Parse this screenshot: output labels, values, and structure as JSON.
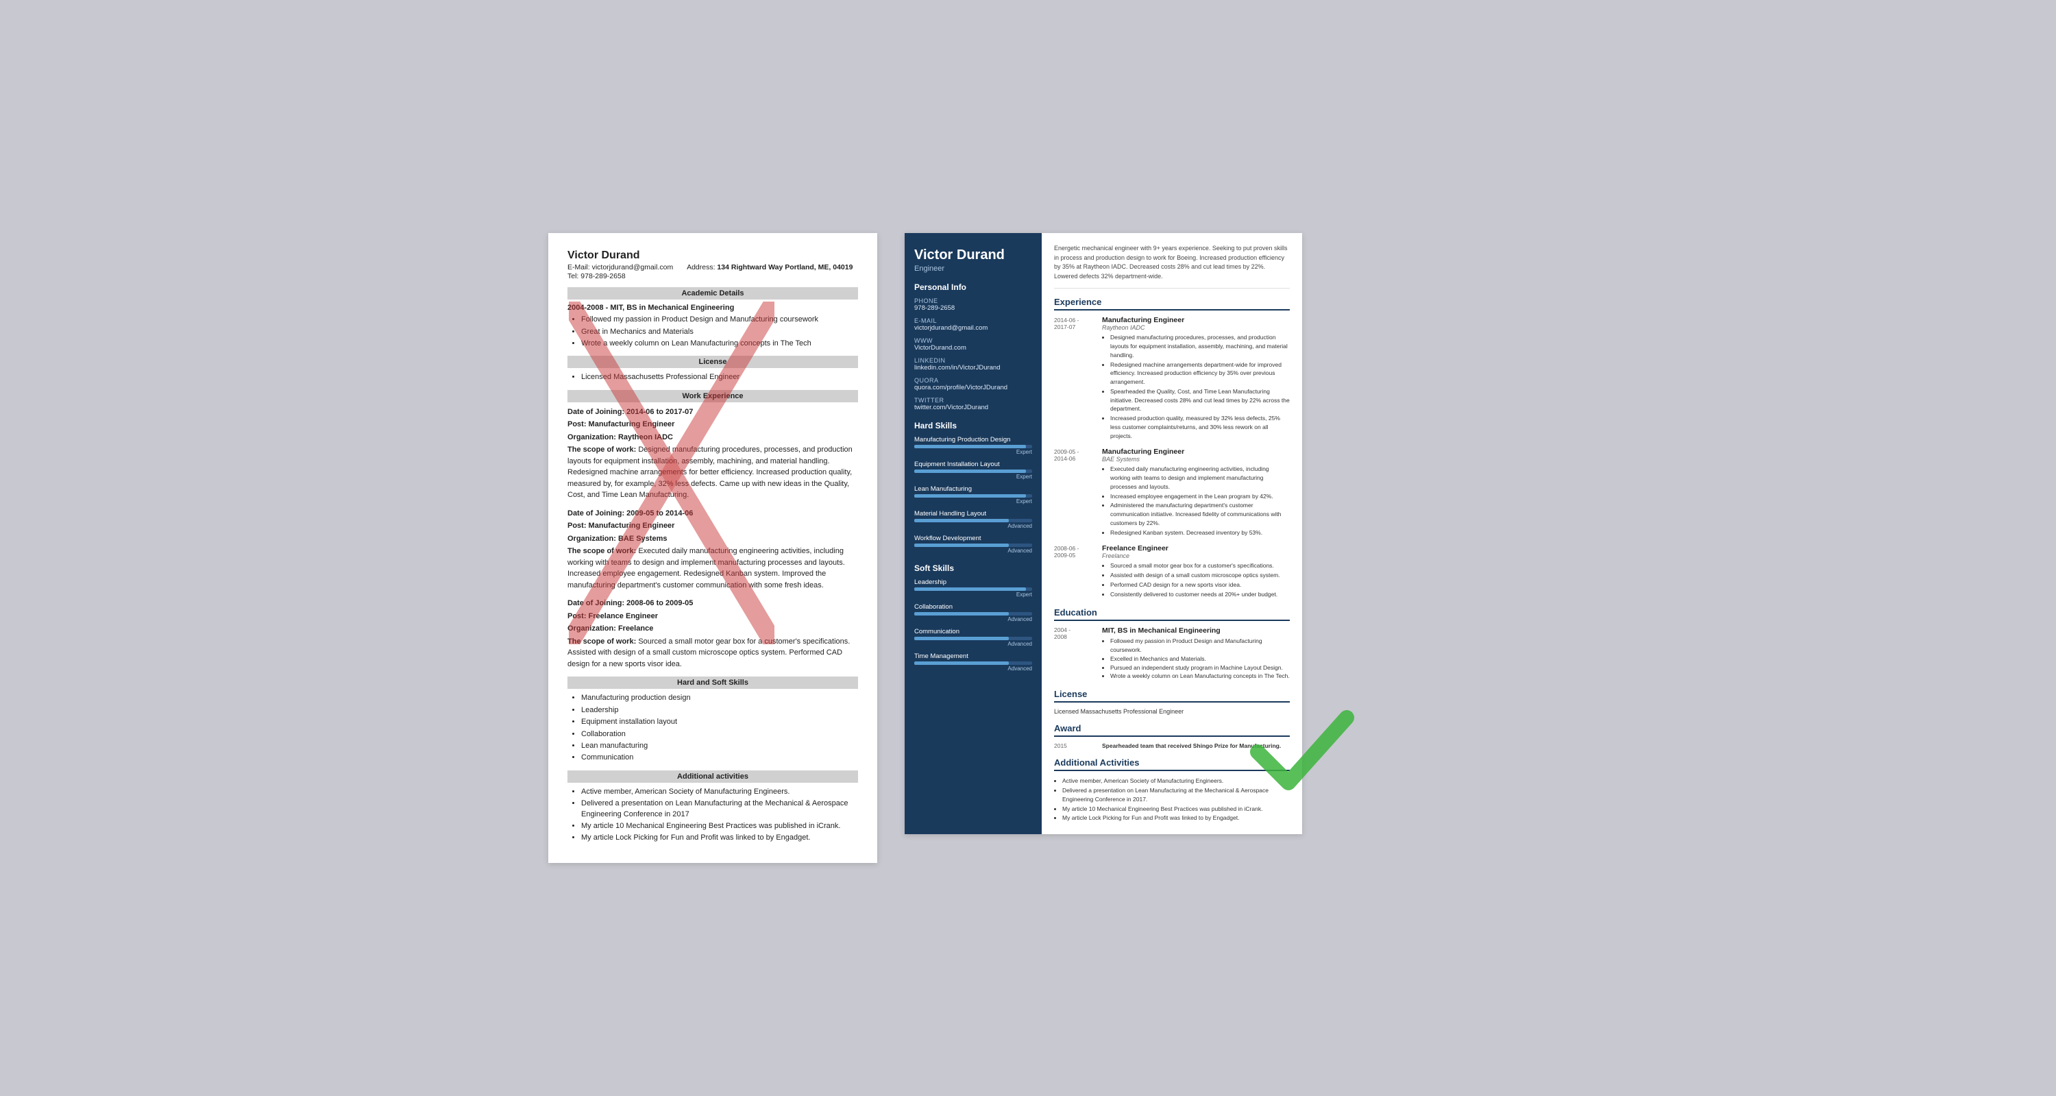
{
  "bad_resume": {
    "name": "Victor Durand",
    "email_label": "E-Mail:",
    "email": "victorjdurand@gmail.com",
    "address_label": "Address:",
    "address": "134 Rightward Way Portland, ME, 04019",
    "tel_label": "Tel:",
    "tel": "978-289-2658",
    "sections": {
      "academic": {
        "header": "Academic Details",
        "degree": "2004-2008 - MIT, BS in Mechanical Engineering",
        "bullets": [
          "Followed my passion in Product Design and Manufacturing coursework",
          "Great in Mechanics and Materials",
          "Wrote a weekly column on Lean Manufacturing concepts in The Tech"
        ]
      },
      "license": {
        "header": "License",
        "text": "Licensed Massachusetts Professional Engineer"
      },
      "work": {
        "header": "Work Experience",
        "entries": [
          {
            "dates": "Date of Joining: 2014-06 to 2017-07",
            "post": "Post: Manufacturing Engineer",
            "org": "Organization: Raytheon IADC",
            "scope_label": "The scope of work:",
            "scope": "Designed manufacturing procedures, processes, and production layouts for equipment installation, assembly, machining, and material handling. Redesigned machine arrangements for better efficiency. Increased production quality, measured by, for example, 32% less defects. Came up with new ideas in the Quality, Cost, and Time Lean Manufacturing."
          },
          {
            "dates": "Date of Joining: 2009-05 to 2014-06",
            "post": "Post: Manufacturing Engineer",
            "org": "Organization: BAE Systems",
            "scope_label": "The scope of work:",
            "scope": "Executed daily manufacturing engineering activities, including working with teams to design and implement manufacturing processes and layouts. Increased employee engagement. Redesigned Kanban system. Improved the manufacturing department's customer communication with some fresh ideas."
          },
          {
            "dates": "Date of Joining: 2008-06 to 2009-05",
            "post": "Post: Freelance Engineer",
            "org": "Organization: Freelance",
            "scope_label": "The scope of work:",
            "scope": "Sourced a small motor gear box for a customer's specifications. Assisted with design of a small custom microscope optics system. Performed CAD design for a new sports visor idea."
          }
        ]
      },
      "skills": {
        "header": "Hard and Soft Skills",
        "bullets": [
          "Manufacturing production design",
          "Leadership",
          "Equipment installation layout",
          "Collaboration",
          "Lean manufacturing",
          "Communication"
        ]
      },
      "additional": {
        "header": "Additional activities",
        "bullets": [
          "Active member, American Society of Manufacturing Engineers.",
          "Delivered a presentation on Lean Manufacturing at the Mechanical & Aerospace Engineering Conference in 2017",
          "My article 10 Mechanical Engineering Best Practices was published in iCrank.",
          "My article Lock Picking for Fun and Profit was linked to by Engadget."
        ]
      }
    }
  },
  "good_resume": {
    "name": "Victor Durand",
    "title": "Engineer",
    "summary": "Energetic mechanical engineer with 9+ years experience. Seeking to put proven skills in process and production design to work for Boeing. Increased production efficiency by 35% at Raytheon IADC. Decreased costs 28% and cut lead times by 22%. Lowered defects 32% department-wide.",
    "sidebar": {
      "personal_info_title": "Personal Info",
      "fields": [
        {
          "label": "Phone",
          "value": "978-289-2658"
        },
        {
          "label": "E-mail",
          "value": "victorjdurand@gmail.com"
        },
        {
          "label": "WWW",
          "value": "VictorDurand.com"
        },
        {
          "label": "LinkedIn",
          "value": "linkedin.com/in/VictorJDurand"
        },
        {
          "label": "Quora",
          "value": "quora.com/profile/VictorJDurand"
        },
        {
          "label": "Twitter",
          "value": "twitter.com/VictorJDurand"
        }
      ],
      "hard_skills_title": "Hard Skills",
      "hard_skills": [
        {
          "name": "Manufacturing Production Design",
          "pct": 95,
          "level": "Expert"
        },
        {
          "name": "Equipment Installation Layout",
          "pct": 95,
          "level": "Expert"
        },
        {
          "name": "Lean Manufacturing",
          "pct": 95,
          "level": "Expert"
        },
        {
          "name": "Material Handling Layout",
          "pct": 80,
          "level": "Advanced"
        },
        {
          "name": "Workflow Development",
          "pct": 80,
          "level": "Advanced"
        }
      ],
      "soft_skills_title": "Soft Skills",
      "soft_skills": [
        {
          "name": "Leadership",
          "pct": 95,
          "level": "Expert"
        },
        {
          "name": "Collaboration",
          "pct": 80,
          "level": "Advanced"
        },
        {
          "name": "Communication",
          "pct": 80,
          "level": "Advanced"
        },
        {
          "name": "Time Management",
          "pct": 80,
          "level": "Advanced"
        }
      ]
    },
    "experience_title": "Experience",
    "experience": [
      {
        "dates": "2014-06 -\n2017-07",
        "title": "Manufacturing Engineer",
        "org": "Raytheon IADC",
        "bullets": [
          "Designed manufacturing procedures, processes, and production layouts for equipment installation, assembly, machining, and material handling.",
          "Redesigned machine arrangements department-wide for improved efficiency. Increased production efficiency by 35% over previous arrangement.",
          "Spearheaded the Quality, Cost, and Time Lean Manufacturing initiative. Decreased costs 28% and cut lead times by 22% across the department.",
          "Increased production quality, measured by 32% less defects, 25% less customer complaints/returns, and 30% less rework on all projects."
        ]
      },
      {
        "dates": "2009-05 -\n2014-06",
        "title": "Manufacturing Engineer",
        "org": "BAE Systems",
        "bullets": [
          "Executed daily manufacturing engineering activities, including working with teams to design and implement manufacturing processes and layouts.",
          "Increased employee engagement in the Lean program by 42%.",
          "Administered the manufacturing department's customer communication initiative. Increased fidelity of communications with customers by 22%.",
          "Redesigned Kanban system. Decreased inventory by 53%."
        ]
      },
      {
        "dates": "2008-06 -\n2009-05",
        "title": "Freelance Engineer",
        "org": "Freelance",
        "bullets": [
          "Sourced a small motor gear box for a customer's specifications.",
          "Assisted with design of a small custom microscope optics system.",
          "Performed CAD design for a new sports visor idea.",
          "Consistently delivered to customer needs at 20%+ under budget."
        ]
      }
    ],
    "education_title": "Education",
    "education": [
      {
        "dates": "2004 -\n2008",
        "degree": "MIT, BS in Mechanical Engineering",
        "bullets": [
          "Followed my passion in Product Design and Manufacturing coursework.",
          "Excelled in Mechanics and Materials.",
          "Pursued an independent study program in Machine Layout Design.",
          "Wrote a weekly column on Lean Manufacturing concepts in The Tech."
        ]
      }
    ],
    "license_title": "License",
    "license_text": "Licensed Massachusetts Professional Engineer",
    "award_title": "Award",
    "award_year": "2015",
    "award_text": "Spearheaded team that received Shingo Prize for Manufacturing.",
    "additional_title": "Additional Activities",
    "additional_bullets": [
      "Active member, American Society of Manufacturing Engineers.",
      "Delivered a presentation on Lean Manufacturing at the Mechanical & Aerospace Engineering Conference in 2017.",
      "My article 10 Mechanical Engineering Best Practices was published in iCrank.",
      "My article Lock Picking for Fun and Profit was linked to by Engadget."
    ]
  }
}
